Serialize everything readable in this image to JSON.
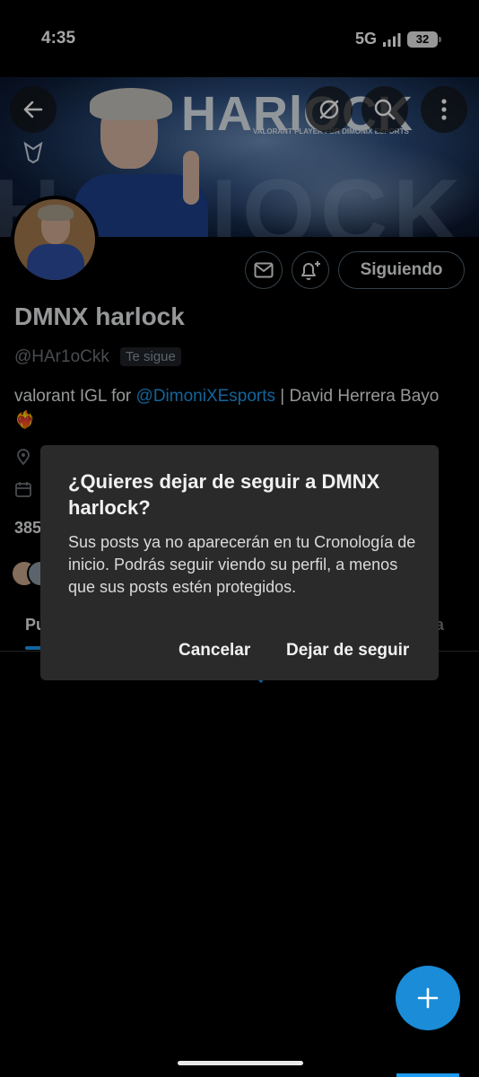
{
  "status_bar": {
    "time": "4:35",
    "network": "5G",
    "battery": "32"
  },
  "banner": {
    "name_text": "HARlOCK",
    "ghost_text": "HARIOCK",
    "subtitle": "VALORANT PLAYER FOR DIMONIX ESPORTS"
  },
  "profile": {
    "name": "DMNX harlock",
    "handle": "@HAr1oCkk",
    "follows_you": "Te sigue",
    "bio_before": "valorant IGL for ",
    "bio_mention": "@DimoniXEsports",
    "bio_after": " | David Herrera Bayo ❤️‍🔥",
    "following_button": "Siguiendo",
    "stats_partial": "385"
  },
  "tabs": {
    "left_partial": "Pu",
    "right_partial": "ia"
  },
  "dialog": {
    "title": "¿Quieres dejar de seguir a DMNX harlock?",
    "body": "Sus posts ya no aparecerán en tu Cronología de inicio. Podrás seguir viendo su perfil, a menos que sus posts estén protegidos.",
    "cancel": "Cancelar",
    "confirm": "Dejar de seguir"
  },
  "icons": {
    "back": "back-arrow-icon",
    "grok": "grok-icon",
    "search": "search-icon",
    "more": "more-vertical-icon",
    "message": "envelope-icon",
    "notify": "bell-plus-icon",
    "location": "location-pin-icon",
    "calendar": "calendar-icon",
    "compose": "plus-icon"
  },
  "colors": {
    "accent": "#1d9bf0",
    "dialog_bg": "#2a2a2a",
    "background": "#000000"
  }
}
